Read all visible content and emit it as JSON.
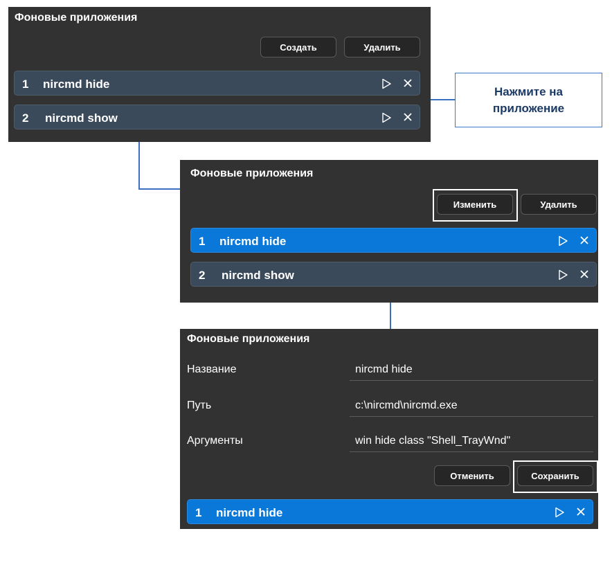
{
  "panel_title": "Фоновые приложения",
  "screen1": {
    "buttons": {
      "create": "Создать",
      "delete": "Удалить"
    },
    "rows": [
      {
        "num": "1",
        "name": "nircmd hide"
      },
      {
        "num": "2",
        "name": "nircmd show"
      }
    ]
  },
  "screen2": {
    "buttons": {
      "edit": "Изменить",
      "delete": "Удалить"
    },
    "rows": [
      {
        "num": "1",
        "name": "nircmd hide",
        "selected": true
      },
      {
        "num": "2",
        "name": "nircmd show"
      }
    ]
  },
  "screen3": {
    "fields": [
      {
        "label": "Название",
        "value": "nircmd hide"
      },
      {
        "label": "Путь",
        "value": "c:\\nircmd\\nircmd.exe"
      },
      {
        "label": "Аргументы",
        "value": "win hide class \"Shell_TrayWnd\""
      }
    ],
    "buttons": {
      "cancel": "Отменить",
      "save": "Сохранить"
    },
    "rows": [
      {
        "num": "1",
        "name": "nircmd hide",
        "selected": true
      }
    ]
  },
  "callout": {
    "line1": "Нажмите на",
    "line2": "приложение"
  },
  "icons": {
    "play": "play-icon",
    "close": "close-icon"
  },
  "colors": {
    "panel": "#323232",
    "row": "#3b4a5a",
    "row_selected": "#0a78d8",
    "connector": "#3b6fc0"
  }
}
